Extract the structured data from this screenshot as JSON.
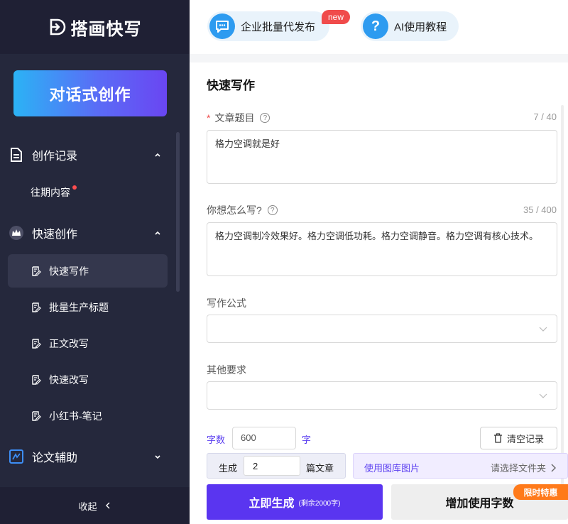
{
  "brand": {
    "name": "搭画快写"
  },
  "sidebar": {
    "dialog_button": "对话式创作",
    "groups": [
      {
        "label": "创作记录",
        "icon": "document-icon",
        "items": [
          {
            "label": "往期内容",
            "dot": true
          }
        ]
      },
      {
        "label": "快速创作",
        "icon": "crown-icon",
        "items": [
          {
            "label": "快速写作",
            "active": true
          },
          {
            "label": "批量生产标题"
          },
          {
            "label": "正文改写"
          },
          {
            "label": "快速改写"
          },
          {
            "label": "小红书-笔记"
          }
        ]
      },
      {
        "label": "论文辅助",
        "icon": "paper-icon",
        "items": []
      }
    ],
    "collapse_label": "收起"
  },
  "topbar": {
    "enterprise_label": "企业批量代发布",
    "new_badge": "new",
    "tutorial_label": "AI使用教程",
    "tutorial_icon_text": "?"
  },
  "form": {
    "title": "快速写作",
    "article_title": {
      "label": "文章题目",
      "counter": "7 / 40",
      "value": "格力空调就是好"
    },
    "how_to_write": {
      "label": "你想怎么写?",
      "counter": "35 / 400",
      "value": "格力空调制冷效果好。格力空调低功耗。格力空调静音。格力空调有核心技术。"
    },
    "formula": {
      "label": "写作公式",
      "value": ""
    },
    "other": {
      "label": "其他要求",
      "value": ""
    },
    "word_count": {
      "label": "字数",
      "value": "600",
      "unit": "字"
    },
    "clear_button": "清空记录",
    "generate": {
      "label_before": "生成",
      "value": "2",
      "label_after": "篇文章"
    },
    "library": {
      "label": "使用图库图片",
      "placeholder": "请选择文件夹"
    },
    "generate_button": {
      "label": "立即生成",
      "remaining": "(剩余2000字)"
    },
    "add_words_button": "增加使用字数",
    "promo_badge": "限时特惠"
  },
  "colors": {
    "sidebar_bg": "#25283c",
    "accent": "#5a35f0",
    "promo": "#ff7a1a"
  }
}
